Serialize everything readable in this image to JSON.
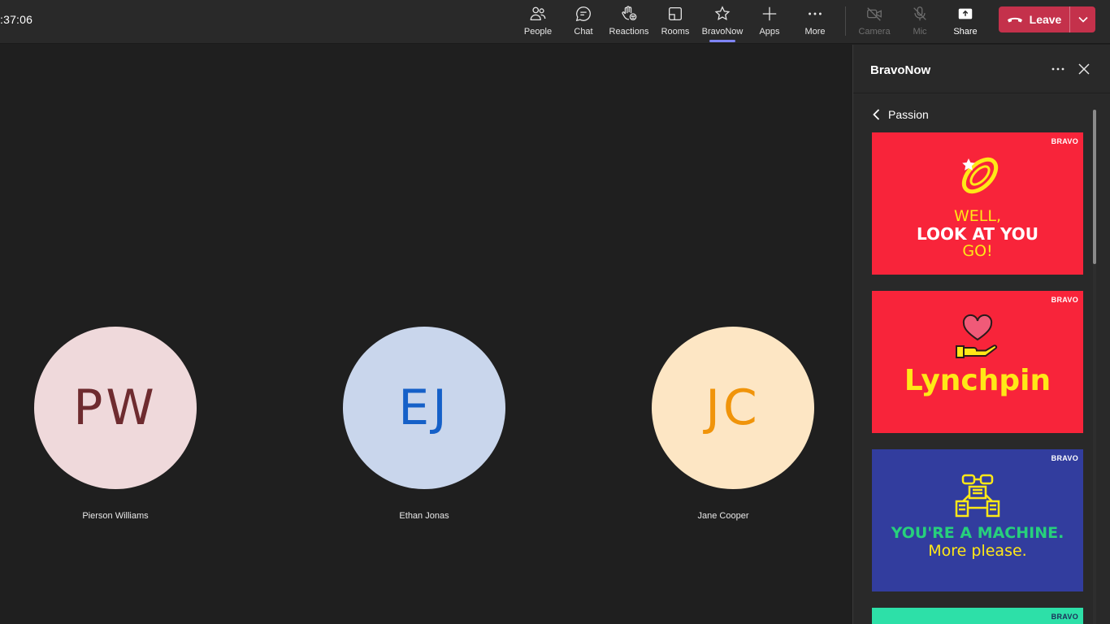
{
  "call": {
    "timer": ":37:06"
  },
  "toolbar": {
    "people": "People",
    "chat": "Chat",
    "reactions": "Reactions",
    "rooms": "Rooms",
    "bravonow": "BravoNow",
    "apps": "Apps",
    "more": "More",
    "camera": "Camera",
    "mic": "Mic",
    "share": "Share",
    "leave": "Leave"
  },
  "participants": [
    {
      "initials": "PW",
      "name": "Pierson Williams",
      "bg": "#efd9db",
      "fg": "#6e2b2f"
    },
    {
      "initials": "EJ",
      "name": "Ethan Jonas",
      "bg": "#c9d6ec",
      "fg": "#1560c8"
    },
    {
      "initials": "JC",
      "name": "Jane Cooper",
      "bg": "#fde6c4",
      "fg": "#f0940a"
    }
  ],
  "panel": {
    "title": "BravoNow",
    "back_label": "Passion",
    "cards": [
      {
        "brand": "BRAVO",
        "line1": "WELL,",
        "line2": "LOOK AT YOU",
        "line3": "GO!",
        "bg": "#f8243a"
      },
      {
        "brand": "BRAVO",
        "line1": "Lynchpin",
        "bg": "#f8243a"
      },
      {
        "brand": "BRAVO",
        "line1": "YOU'RE A MACHINE.",
        "line2": "More please.",
        "bg": "#323d9e"
      },
      {
        "brand": "BRAVO",
        "bg": "#2de0a8"
      }
    ]
  },
  "colors": {
    "accent": "#7f85f5",
    "leave": "#c4314b",
    "card_yellow": "#ffe817",
    "card_green": "#27d07c"
  }
}
